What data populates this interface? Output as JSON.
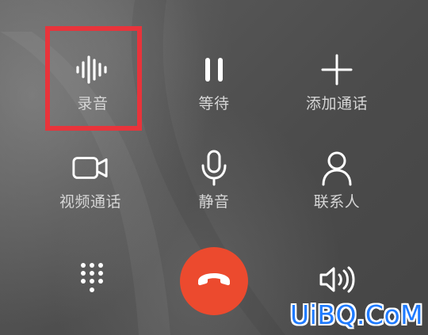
{
  "controls": {
    "record": {
      "label": "录音",
      "icon": "waveform-icon"
    },
    "hold": {
      "label": "等待",
      "icon": "pause-icon"
    },
    "add_call": {
      "label": "添加通话",
      "icon": "plus-icon"
    },
    "video": {
      "label": "视频通话",
      "icon": "video-camera-icon"
    },
    "mute": {
      "label": "静音",
      "icon": "microphone-icon"
    },
    "contacts": {
      "label": "联系人",
      "icon": "person-icon"
    }
  },
  "bottom": {
    "keypad": {
      "icon": "dialpad-icon"
    },
    "hangup": {
      "icon": "hang-up-icon",
      "color": "#ec4a2e"
    },
    "speaker": {
      "icon": "speaker-icon"
    }
  },
  "highlight": {
    "target": "record",
    "color": "#e8343b"
  },
  "watermark": {
    "text": "UiBQ.CoM",
    "color": "#1f7bff"
  }
}
